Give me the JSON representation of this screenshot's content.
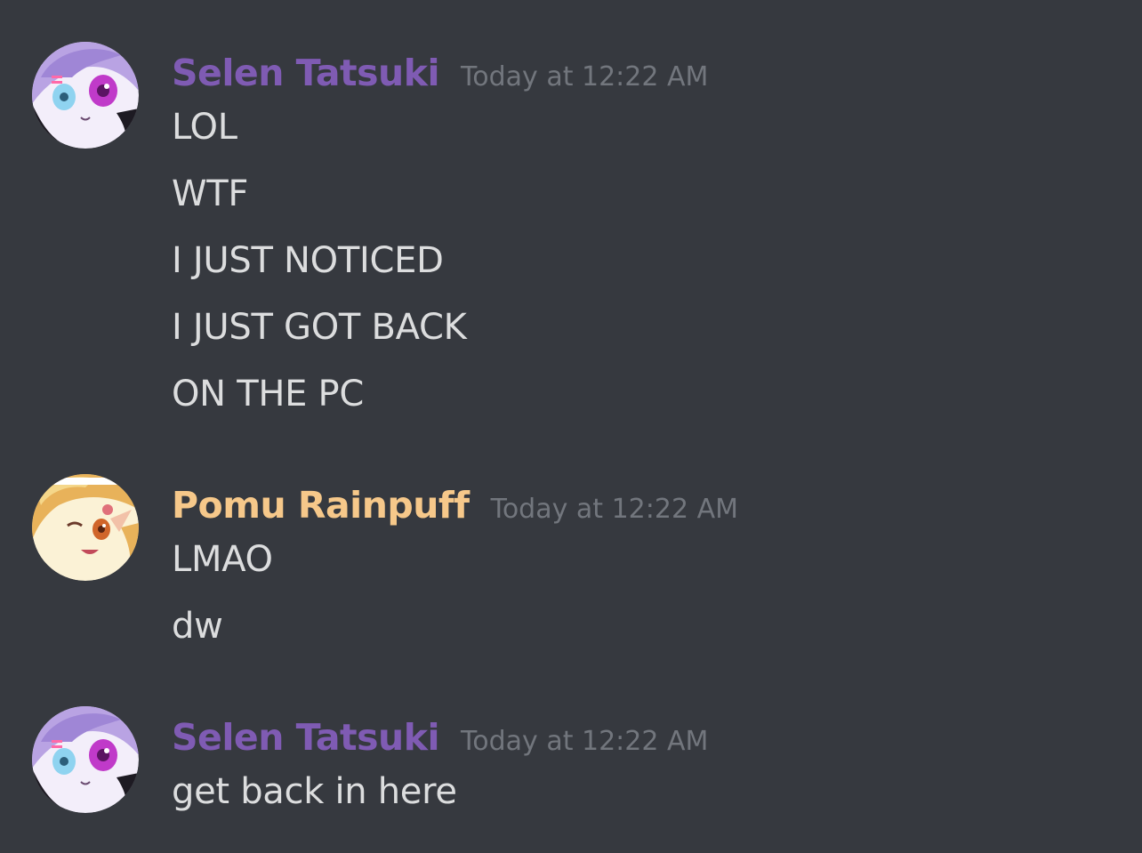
{
  "messages": [
    {
      "author": "Selen Tatsuki",
      "author_color": "#7f5bb3",
      "timestamp": "Today at 12:22 AM",
      "avatar_icon": "selen-avatar-icon",
      "lines": [
        "LOL",
        "WTF",
        "I JUST NOTICED",
        "I JUST GOT BACK",
        "ON THE PC"
      ]
    },
    {
      "author": "Pomu Rainpuff",
      "author_color": "#f6c88a",
      "timestamp": "Today at 12:22 AM",
      "avatar_icon": "pomu-avatar-icon",
      "lines": [
        "LMAO",
        "dw"
      ]
    },
    {
      "author": "Selen Tatsuki",
      "author_color": "#7f5bb3",
      "timestamp": "Today at 12:22 AM",
      "avatar_icon": "selen-avatar-icon",
      "lines": [
        "get back in here"
      ]
    }
  ],
  "colors": {
    "background": "#36393f",
    "message_text": "#dcddde",
    "timestamp": "#72767d"
  }
}
